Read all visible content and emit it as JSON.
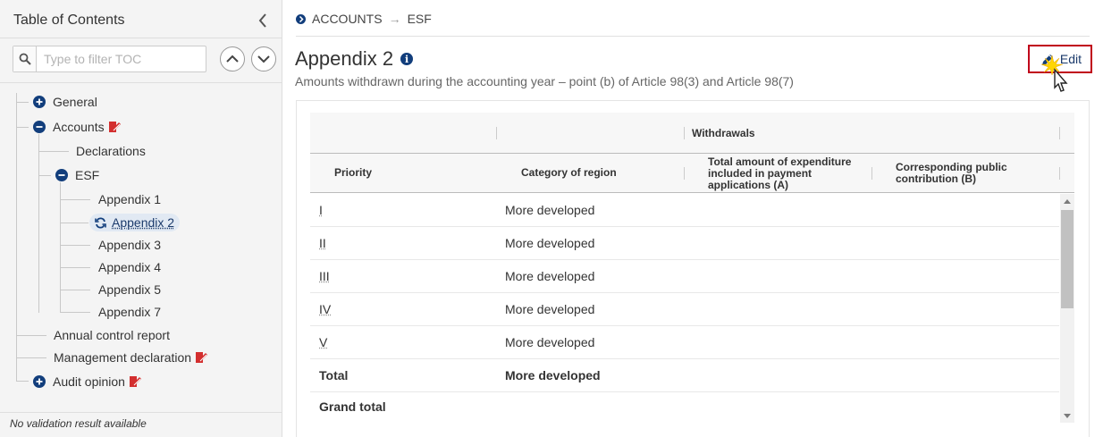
{
  "sidebar": {
    "title": "Table of Contents",
    "filter_placeholder": "Type to filter TOC",
    "items": [
      {
        "label": "General"
      },
      {
        "label": "Accounts"
      },
      {
        "label": "Declarations"
      },
      {
        "label": "ESF"
      },
      {
        "label": "Appendix 1"
      },
      {
        "label": "Appendix 2"
      },
      {
        "label": "Appendix 3"
      },
      {
        "label": "Appendix 4"
      },
      {
        "label": "Appendix 5"
      },
      {
        "label": "Appendix 7"
      },
      {
        "label": "Annual control report"
      },
      {
        "label": "Management declaration"
      },
      {
        "label": "Audit opinion"
      }
    ],
    "footer": "No validation result available"
  },
  "breadcrumb": {
    "first": "ACCOUNTS",
    "separator": "→",
    "second": "ESF"
  },
  "page": {
    "title": "Appendix 2",
    "subtitle": "Amounts withdrawn during the accounting year – point (b) of Article 98(3) and Article 98(7)",
    "edit_label": "Edit"
  },
  "table": {
    "group_header": "Withdrawals",
    "headers": {
      "priority": "Priority",
      "category": "Category of region",
      "total": "Total amount of expenditure included in payment applications   (A)",
      "public": "Corresponding public contribution   (B)"
    },
    "rows": [
      {
        "priority": "I",
        "category": "More developed"
      },
      {
        "priority": "II",
        "category": "More developed"
      },
      {
        "priority": "III",
        "category": "More developed"
      },
      {
        "priority": "IV",
        "category": "More developed"
      },
      {
        "priority": "V",
        "category": "More developed"
      },
      {
        "priority": "Total",
        "category": "More developed"
      },
      {
        "priority": "Grand total",
        "category": ""
      }
    ]
  },
  "colors": {
    "accent": "#123e7c",
    "edit_border": "#c0001a",
    "warning": "#d32f2f"
  }
}
